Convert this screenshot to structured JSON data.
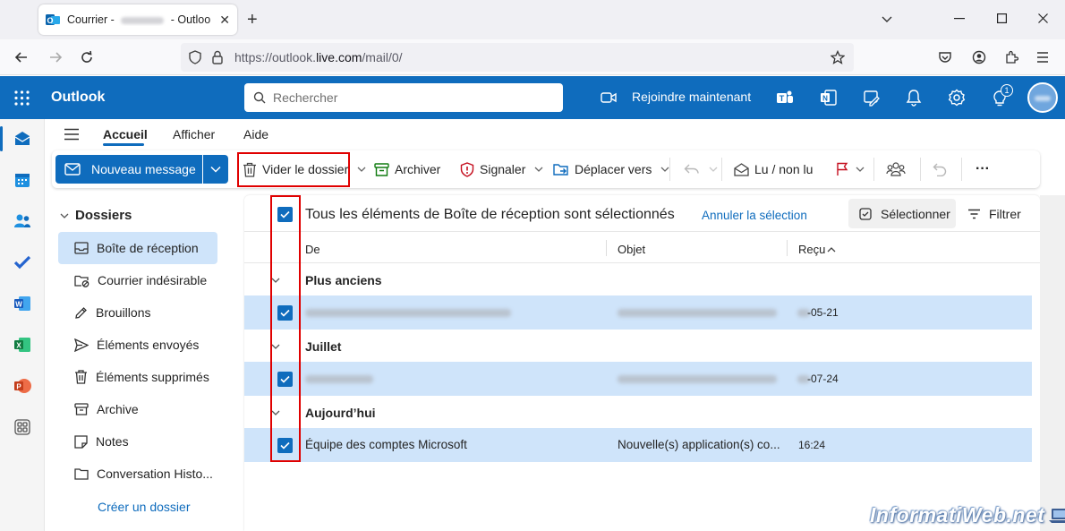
{
  "browser": {
    "tab_title_prefix": "Courrier - ",
    "tab_title_suffix": " - Outloo",
    "url_prefix": "https://outlook.",
    "url_domain": "live.com",
    "url_path": "/mail/0/"
  },
  "header": {
    "app_name": "Outlook",
    "search_placeholder": "Rechercher",
    "join_label": "Rejoindre maintenant",
    "notif_count": "1"
  },
  "ribbon": {
    "tabs": [
      "Accueil",
      "Afficher",
      "Aide"
    ]
  },
  "toolbar": {
    "new_message": "Nouveau message",
    "empty_folder": "Vider le dossier",
    "archive": "Archiver",
    "report": "Signaler",
    "move_to": "Déplacer vers",
    "read_unread": "Lu / non lu",
    "more": "···"
  },
  "folders": {
    "heading": "Dossiers",
    "items": [
      "Boîte de réception",
      "Courrier indésirable",
      "Brouillons",
      "Éléments envoyés",
      "Éléments supprimés",
      "Archive",
      "Notes",
      "Conversation Histo..."
    ],
    "create": "Créer un dossier"
  },
  "list": {
    "banner": "Tous les éléments de Boîte de réception sont sélectionnés",
    "cancel_selection": "Annuler la sélection",
    "select_btn": "Sélectionner",
    "filter_btn": "Filtrer",
    "col_from": "De",
    "col_subject": "Objet",
    "col_received": "Reçu",
    "groups": [
      {
        "label": "Plus anciens",
        "date": "-05-21"
      },
      {
        "label": "Juillet",
        "date": "-07-24"
      },
      {
        "label": "Aujourd’hui",
        "from": "Équipe des comptes Microsoft",
        "subject": "Nouvelle(s) application(s) co...",
        "date": "16:24"
      }
    ]
  },
  "watermark": "InformatiWeb.net",
  "colors": {
    "brand": "#0f6cbd",
    "selected_row": "#cfe4fa",
    "highlight_box": "#e00000"
  }
}
